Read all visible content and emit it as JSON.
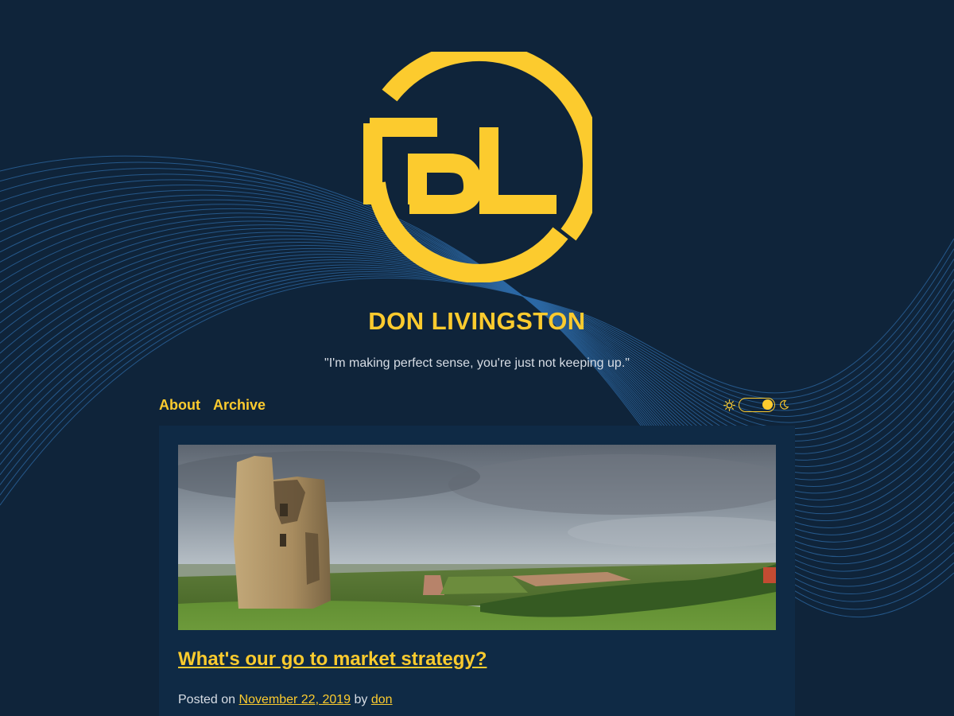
{
  "site": {
    "logo_text": "DL",
    "title": "DON LIVINGSTON",
    "tagline": "\"I'm making perfect sense, you're just not keeping up.\""
  },
  "nav": {
    "items": [
      {
        "label": "About"
      },
      {
        "label": "Archive"
      }
    ]
  },
  "theme_toggle": {
    "state": "dark",
    "left_icon": "sun-icon",
    "right_icon": "moon-icon"
  },
  "post": {
    "image_alt": "Ruined stone castle tower on a grassy hill overlooking flat fields under a cloudy sky",
    "title": "What's our go to market strategy?",
    "meta": {
      "prefix": "Posted on",
      "date": "November 22, 2019",
      "by": "by",
      "author": "don"
    }
  },
  "colors": {
    "background": "#0f243a",
    "card": "#0f2a45",
    "accent": "#fccb2e",
    "text": "#d7dde5",
    "wave_lines": "#2d6aa6"
  }
}
